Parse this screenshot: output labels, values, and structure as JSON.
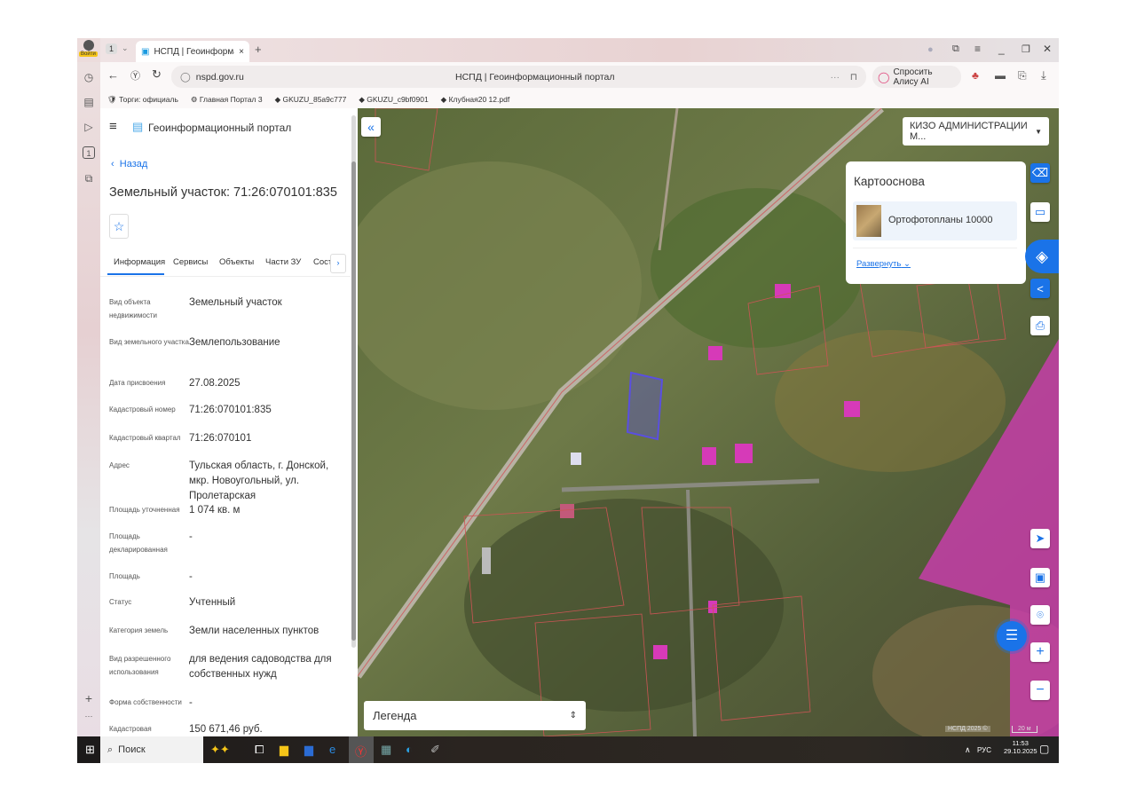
{
  "browser": {
    "profile_label": "Войти",
    "tab_count": "1",
    "tab_title": "НСПД | Геоинформац",
    "url": "nspd.gov.ru",
    "page_title": "НСПД | Геоинформационный портал",
    "alice_label": "Спросить Алису AI",
    "bookmarks": [
      "Торги: официаль",
      "Главная Портал 3",
      "GKUZU_85a9c777",
      "GKUZU_c9bf0901",
      "Клубная20 12.pdf"
    ]
  },
  "panel": {
    "app_title": "Геоинформационный портал",
    "back_label": "Назад",
    "title": "Земельный участок: 71:26:070101:835",
    "tabs": [
      "Информация",
      "Сервисы",
      "Объекты",
      "Части ЗУ",
      "Соста"
    ],
    "fields": [
      {
        "label": "Вид объекта недвижимости",
        "value": "Земельный участок"
      },
      {
        "label": "Вид земельного участка",
        "value": "Землепользование"
      },
      {
        "label": "Дата присвоения",
        "value": "27.08.2025"
      },
      {
        "label": "Кадастровый номер",
        "value": "71:26:070101:835"
      },
      {
        "label": "Кадастровый квартал",
        "value": "71:26:070101"
      },
      {
        "label": "Адрес",
        "value": "Тульская область, г. Донской, мкр. Новоугольный, ул. Пролетарская"
      },
      {
        "label": "Площадь уточненная",
        "value": "1 074 кв. м"
      },
      {
        "label": "Площадь декларированная",
        "value": "-"
      },
      {
        "label": "Площадь",
        "value": "-"
      },
      {
        "label": "Статус",
        "value": "Учтенный"
      },
      {
        "label": "Категория земель",
        "value": "Земли населенных пунктов"
      },
      {
        "label": "Вид разрешенного использования",
        "value": "для ведения садоводства для собственных нужд"
      },
      {
        "label": "Форма собственности",
        "value": "-"
      },
      {
        "label": "Кадастровая",
        "value": "150 671,46 руб."
      }
    ]
  },
  "map": {
    "org_select": "КИЗО АДМИНИСТРАЦИИ М...",
    "basemap_title": "Картооснова",
    "basemap_item": "Ортофотопланы 10000",
    "expand_label": "Развернуть",
    "legend_label": "Легенда",
    "attribution": "НСПД 2025 ©",
    "scale": "20 м",
    "colors": {
      "accent": "#1a73e8",
      "zone": "#d63ab8",
      "selected": "#5a4fe0"
    }
  },
  "taskbar": {
    "search": "Поиск",
    "lang": "РУС",
    "time": "11:53",
    "date": "29.10.2025"
  }
}
